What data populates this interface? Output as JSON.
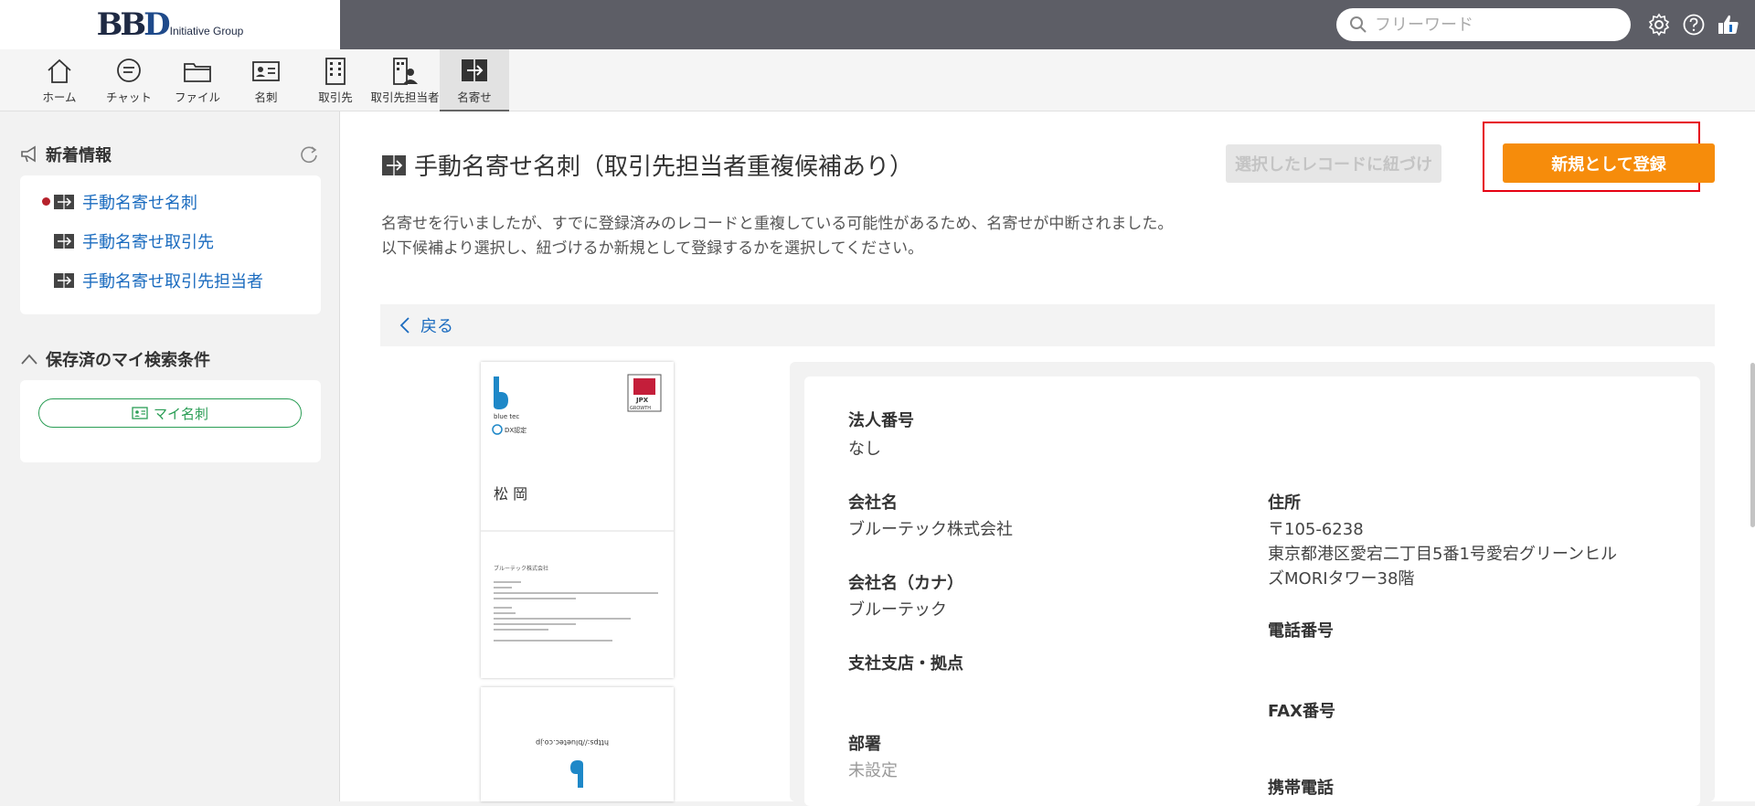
{
  "brand": {
    "logo": "BBD",
    "sub": "Initiative Group"
  },
  "search": {
    "placeholder": "フリーワード"
  },
  "nav": [
    {
      "label": "ホーム",
      "icon": "home-icon"
    },
    {
      "label": "チャット",
      "icon": "chat-icon"
    },
    {
      "label": "ファイル",
      "icon": "folder-icon"
    },
    {
      "label": "名刺",
      "icon": "business-card-icon"
    },
    {
      "label": "取引先",
      "icon": "building-icon"
    },
    {
      "label": "取引先担当者",
      "icon": "building-person-icon"
    },
    {
      "label": "名寄せ",
      "icon": "merge-icon",
      "active": true
    }
  ],
  "sidebar": {
    "news_title": "新着情報",
    "news_items": [
      {
        "label": "手動名寄せ名刺",
        "unread": true
      },
      {
        "label": "手動名寄せ取引先",
        "unread": false
      },
      {
        "label": "手動名寄せ取引先担当者",
        "unread": false
      }
    ],
    "saved_title": "保存済のマイ検索条件",
    "saved_pill": "マイ名刺"
  },
  "main": {
    "title": "手動名寄せ名刺（取引先担当者重複候補あり）",
    "btn_link": "選択したレコードに紐づけ",
    "btn_register": "新規として登録",
    "desc_line1": "名寄せを行いましたが、すでに登録済みのレコードと重複している可能性があるため、名寄せが中断されました。",
    "desc_line2": "以下候補より選択し、紐づけるか新規として登録するかを選択してください。",
    "back": "戻る"
  },
  "card": {
    "brand": "blue tec",
    "dx": "DX認定",
    "jpx": "JPX",
    "jpx_sub": "GROWTH",
    "name": "松 岡",
    "company": "ブルーテック株式会社",
    "url_back": "https://bluetec.co.jp"
  },
  "detail": {
    "corp_no_label": "法人番号",
    "corp_no": "なし",
    "company_label": "会社名",
    "company": "ブルーテック株式会社",
    "company_kana_label": "会社名（カナ）",
    "company_kana": "ブルーテック",
    "branch_label": "支社支店・拠点",
    "dept_label": "部署",
    "dept": "未設定",
    "address_label": "住所",
    "postal": "〒105-6238",
    "address_1": "東京都港区愛宕二丁目5番1号愛宕グリーンヒル",
    "address_2": "ズMORIタワー38階",
    "phone_label": "電話番号",
    "fax_label": "FAX番号",
    "mobile_label": "携帯電話"
  },
  "colors": {
    "accent": "#f68c0b",
    "link": "#1a6bbf",
    "highlight": "#e60012",
    "topbar": "#5d5e66"
  }
}
